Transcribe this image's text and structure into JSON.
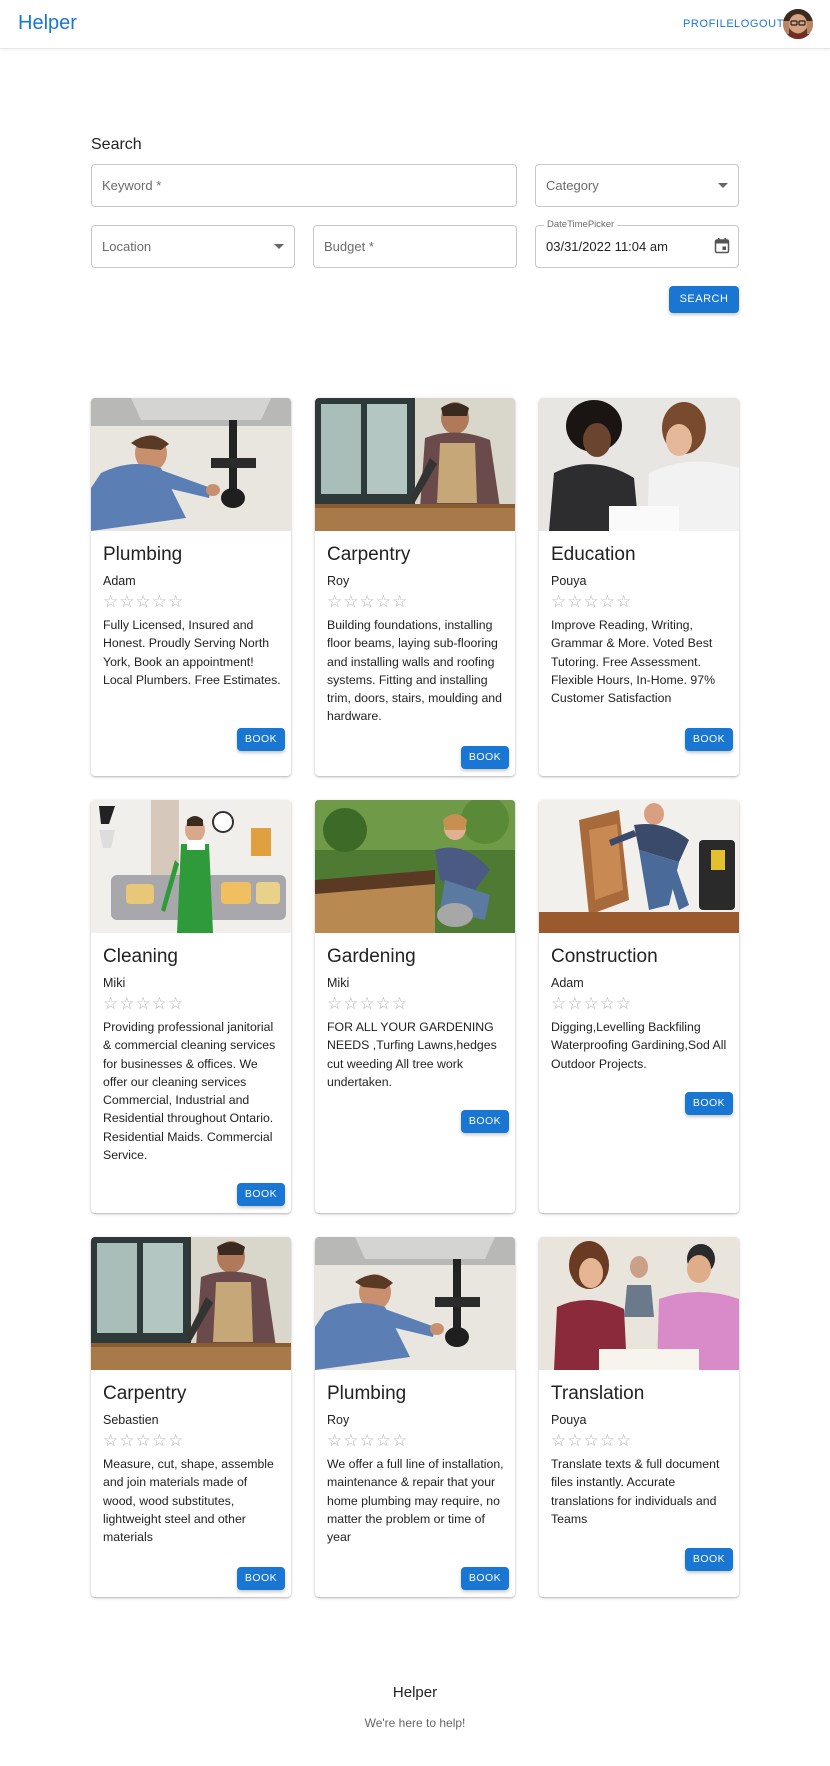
{
  "app": {
    "brand": "Helper"
  },
  "nav": {
    "profile": "PROFILE",
    "logout": "LOGOUT"
  },
  "search": {
    "title": "Search",
    "keyword_placeholder": "Keyword *",
    "category_placeholder": "Category",
    "location_placeholder": "Location",
    "budget_placeholder": "Budget *",
    "datetime_label": "DateTimePicker",
    "datetime_value": "03/31/2022 11:04 am",
    "button": "SEARCH"
  },
  "colors": {
    "accent": "#1976d2",
    "star": "#b5b5b5"
  },
  "cards": [
    {
      "title": "Plumbing",
      "person": "Adam",
      "rating": 0,
      "stars": "☆☆☆☆☆",
      "description": "Fully Licensed, Insured and Honest. Proudly Serving North York, Book an appointment! Local Plumbers. Free Estimates.",
      "button": "BOOK",
      "image": "plumber-photo"
    },
    {
      "title": "Carpentry",
      "person": "Roy",
      "rating": 0,
      "stars": "☆☆☆☆☆",
      "description": "Building foundations, installing floor beams, laying sub-flooring and installing walls and roofing systems. Fitting and installing trim, doors, stairs, moulding and hardware.",
      "button": "BOOK",
      "image": "carpenter-photo"
    },
    {
      "title": "Education",
      "person": "Pouya",
      "rating": 0,
      "stars": "☆☆☆☆☆",
      "description": "Improve Reading, Writing, Grammar & More. Voted Best Tutoring. Free Assessment. Flexible Hours, In-Home. 97% Customer Satisfaction",
      "button": "BOOK",
      "image": "tutoring-photo"
    },
    {
      "title": "Cleaning",
      "person": "Miki",
      "rating": 0,
      "stars": "☆☆☆☆☆",
      "description": "Providing professional janitorial & commercial cleaning services for businesses & offices. We offer our cleaning services Commercial, Industrial and Residential throughout Ontario. Residential Maids. Commercial Service.",
      "button": "BOOK",
      "image": "cleaner-photo"
    },
    {
      "title": "Gardening",
      "person": "Miki",
      "rating": 0,
      "stars": "☆☆☆☆☆",
      "description": "FOR ALL YOUR GARDENING NEEDS ,Turfing Lawns,hedges cut weeding All tree work undertaken.",
      "button": "BOOK",
      "image": "gardener-photo"
    },
    {
      "title": "Construction",
      "person": "Adam",
      "rating": 0,
      "stars": "☆☆☆☆☆",
      "description": "Digging,Levelling Backfiling Waterproofing Gardining,Sod All Outdoor Projects.",
      "button": "BOOK",
      "image": "construction-photo"
    },
    {
      "title": "Carpentry",
      "person": "Sebastien",
      "rating": 0,
      "stars": "☆☆☆☆☆",
      "description": "Measure, cut, shape, assemble and join materials made of wood, wood substitutes, lightweight steel and other materials",
      "button": "BOOK",
      "image": "carpenter-photo"
    },
    {
      "title": "Plumbing",
      "person": "Roy",
      "rating": 0,
      "stars": "☆☆☆☆☆",
      "description": "We offer a full line of installation, maintenance & repair that your home plumbing may require, no matter the problem or time of year",
      "button": "BOOK",
      "image": "plumber-photo"
    },
    {
      "title": "Translation",
      "person": "Pouya",
      "rating": 0,
      "stars": "☆☆☆☆☆",
      "description": "Translate texts & full document files instantly. Accurate translations for individuals and Teams",
      "button": "BOOK",
      "image": "translation-photo"
    }
  ],
  "footer": {
    "title": "Helper",
    "subtitle": "We're here to help!"
  }
}
